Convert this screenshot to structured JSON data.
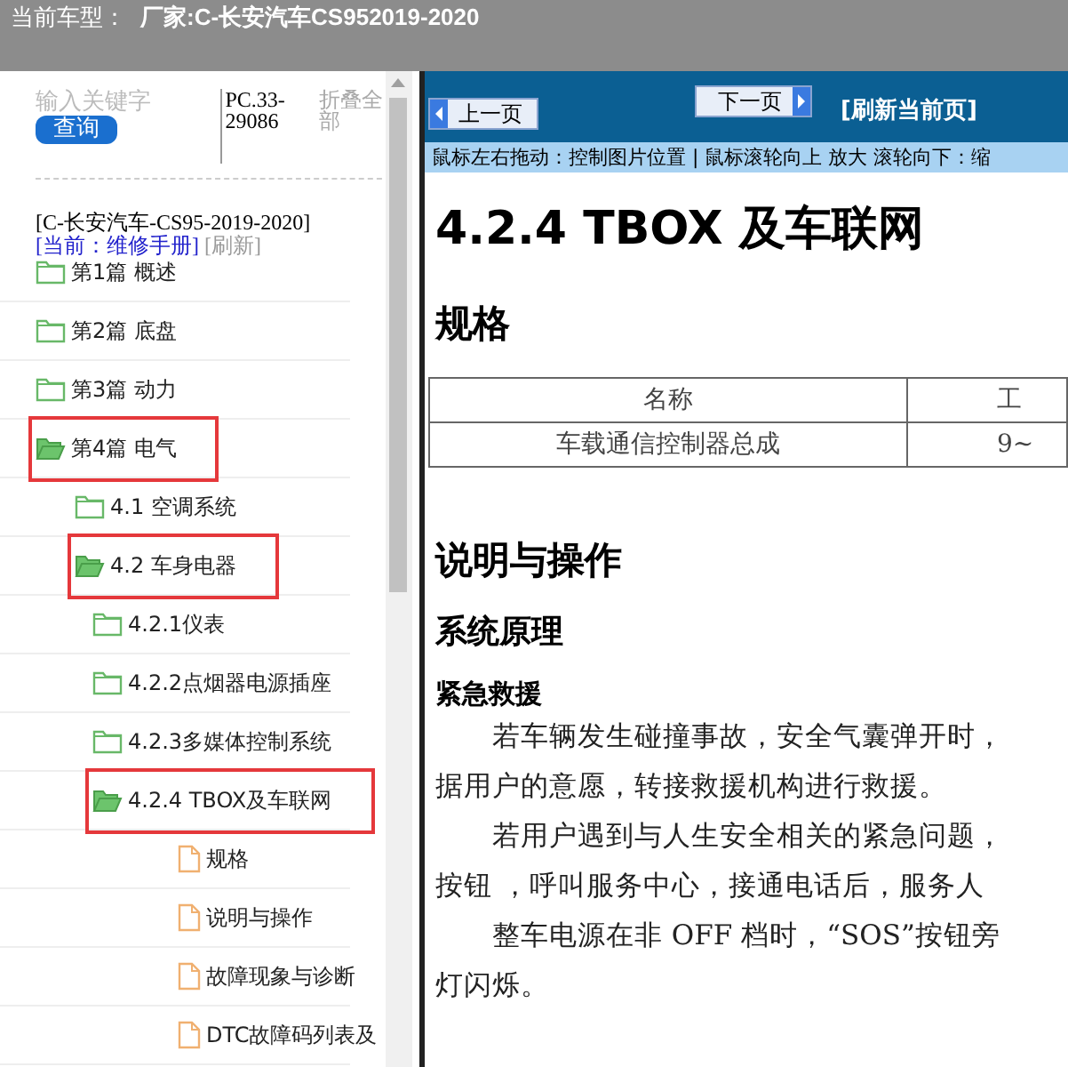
{
  "header": {
    "label": "当前车型：",
    "value": "厂家:C-长安汽车CS952019-2020"
  },
  "sidebar": {
    "search": {
      "placeholder": "输入关键字"
    },
    "search_button": "查询",
    "code": "PC.33-29086",
    "collapse_all": "折叠全部",
    "model": "[C-长安汽车-CS95-2019-2020]",
    "current": "[当前：维修手册]",
    "refresh": "[刷新]",
    "tree": [
      {
        "kind": "folder",
        "label": "第1篇 概述",
        "expanded": false,
        "selected": false
      },
      {
        "kind": "folder",
        "label": "第2篇 底盘",
        "expanded": false,
        "selected": false
      },
      {
        "kind": "folder",
        "label": "第3篇 动力",
        "expanded": false,
        "selected": false
      },
      {
        "kind": "folder",
        "label": "第4篇 电气",
        "expanded": true,
        "selected": true,
        "children": [
          {
            "kind": "folder",
            "label": "4.1 空调系统",
            "expanded": false,
            "selected": false
          },
          {
            "kind": "folder",
            "label": "4.2 车身电器",
            "expanded": true,
            "selected": true,
            "children": [
              {
                "kind": "folder",
                "label": "4.2.1仪表",
                "expanded": false,
                "selected": false
              },
              {
                "kind": "folder",
                "label": "4.2.2点烟器电源插座",
                "expanded": false,
                "selected": false
              },
              {
                "kind": "folder",
                "label": "4.2.3多媒体控制系统",
                "expanded": false,
                "selected": false
              },
              {
                "kind": "folder",
                "label": "4.2.4 TBOX及车联网",
                "expanded": true,
                "selected": true,
                "children": [
                  {
                    "kind": "doc",
                    "label": "规格",
                    "selected": false
                  },
                  {
                    "kind": "doc",
                    "label": "说明与操作",
                    "selected": false
                  },
                  {
                    "kind": "doc",
                    "label": "故障现象与诊断",
                    "selected": false
                  },
                  {
                    "kind": "doc",
                    "label": "DTC故障码列表及",
                    "selected": false
                  }
                ]
              }
            ]
          }
        ]
      }
    ]
  },
  "viewer": {
    "prev_button": "上一页",
    "next_button": "下一页",
    "refresh_page": "[刷新当前页]",
    "hint": "鼠标左右拖动：控制图片位置 | 鼠标滚轮向上 放大  滚轮向下：缩",
    "document": {
      "title": "4.2.4 TBOX 及车联网",
      "spec_heading": "规格",
      "table": {
        "columns": [
          "名称",
          "工"
        ],
        "rows": [
          [
            "车载通信控制器总成",
            "9~"
          ]
        ]
      },
      "section_heading": "说明与操作",
      "subsection_heading": "系统原理",
      "topic_heading": "紧急救援",
      "lines": [
        {
          "text": "若车辆发生碰撞事故，安全气囊弹开时，",
          "indent": true
        },
        {
          "text": "据用户的意愿，转接救援机构进行救援。",
          "indent": false
        },
        {
          "text": "若用户遇到与人生安全相关的紧急问题，",
          "indent": true
        },
        {
          "text": "按钮 ，呼叫服务中心，接通电话后，服务人",
          "indent": false
        },
        {
          "text": "整车电源在非 OFF 档时，“SOS”按钮旁",
          "indent": true
        },
        {
          "text": "灯闪烁。",
          "indent": false
        }
      ]
    }
  }
}
